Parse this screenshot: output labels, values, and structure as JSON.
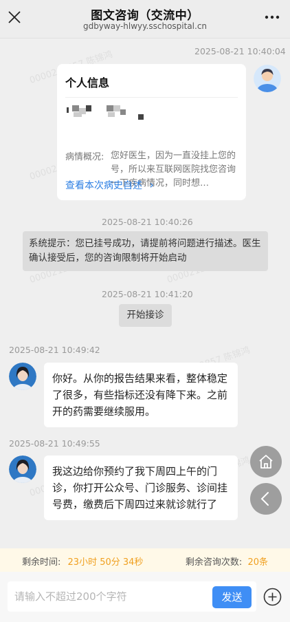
{
  "header": {
    "title": "图文咨询（交流中）",
    "subtitle": "gdbyway-hlwyy.sschospital.cn"
  },
  "watermark": "0000212857 陈锦鸿",
  "messages": {
    "ts1": "2025-08-21 10:40:04",
    "ts2": "2025-08-21 10:40:26",
    "ts3": "2025-08-21 10:41:20",
    "ts4": "2025-08-21 10:49:42",
    "ts5": "2025-08-21 10:49:55"
  },
  "card": {
    "title": "个人信息",
    "condition_label": "病情概况:",
    "condition_text": "您好医生，因为一直没挂上您的号，所以来互联网医院找您咨询一下疾病情况，同时想…",
    "link": "查看本次病史自述",
    "link_chevron": "›"
  },
  "system": {
    "notice": "系统提示：您已挂号成功，请提前将问题进行描述。医生确认接受后，您的咨询限制将开始启动",
    "start": "开始接诊"
  },
  "doctor_msgs": [
    "你好。从你的报告结果来看，整体稳定了很多，有些指标还没有降下来。之前开的药需要继续服用。",
    "我这边给你预约了我下周四上午的门诊，你打开公众号、门诊服务、诊间挂号费，缴费后下周四过来就诊就行了"
  ],
  "info_bar": {
    "time_label": "剩余时间:",
    "time_value": "23小时 50分 34秒",
    "count_label": "剩余咨询次数:",
    "count_value": "20条"
  },
  "input": {
    "placeholder": "请输入不超过200个字符",
    "send": "发送"
  },
  "icons": {
    "close": "close-icon",
    "more": "more-icon",
    "home": "home-icon",
    "back": "back-arrow-icon",
    "plus": "plus-circle-icon",
    "patient": "patient-avatar",
    "doctor": "doctor-avatar"
  },
  "colors": {
    "accent": "#3f8ef5",
    "link": "#2d7fe3",
    "highlight": "#f0a020"
  }
}
